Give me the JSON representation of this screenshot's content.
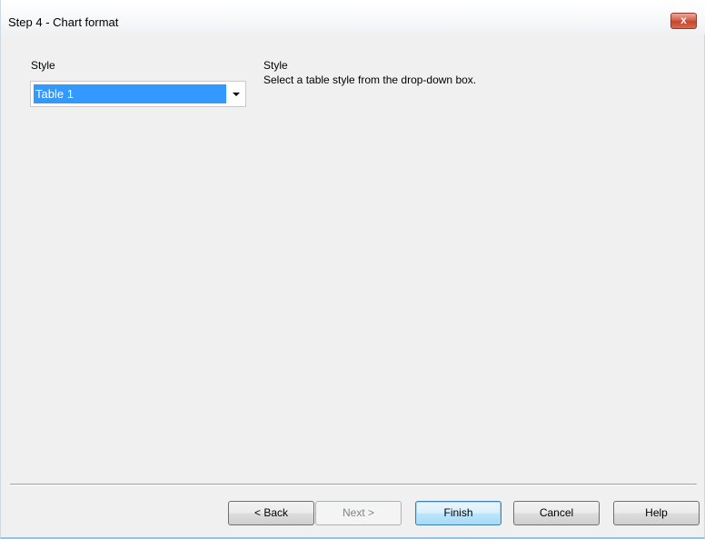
{
  "window": {
    "title": "Step 4 - Chart format",
    "close_label": "x"
  },
  "style_section": {
    "label": "Style",
    "selected_value": "Table 1"
  },
  "help": {
    "title": "Style",
    "description": "Select a table style from the drop-down box."
  },
  "buttons": {
    "back": "< Back",
    "next": "Next >",
    "finish": "Finish",
    "cancel": "Cancel",
    "help": "Help"
  },
  "icons": {
    "close": "close-icon",
    "dropdown": "chevron-down-icon"
  },
  "colors": {
    "selection": "#3399ff",
    "close_button": "#c4452c",
    "default_button_border": "#3c7fb1"
  }
}
